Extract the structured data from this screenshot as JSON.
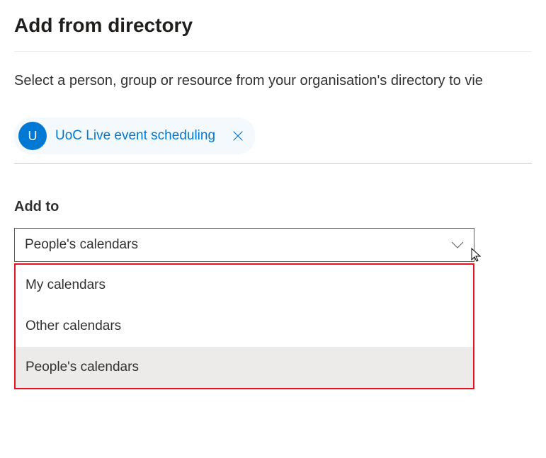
{
  "header": {
    "title": "Add from directory"
  },
  "instruction": "Select a person, group or resource from your organisation's directory to vie",
  "chip": {
    "avatarLetter": "U",
    "label": "UoC Live event scheduling"
  },
  "addTo": {
    "label": "Add to",
    "selected": "People's calendars",
    "options": [
      "My calendars",
      "Other calendars",
      "People's calendars"
    ]
  }
}
